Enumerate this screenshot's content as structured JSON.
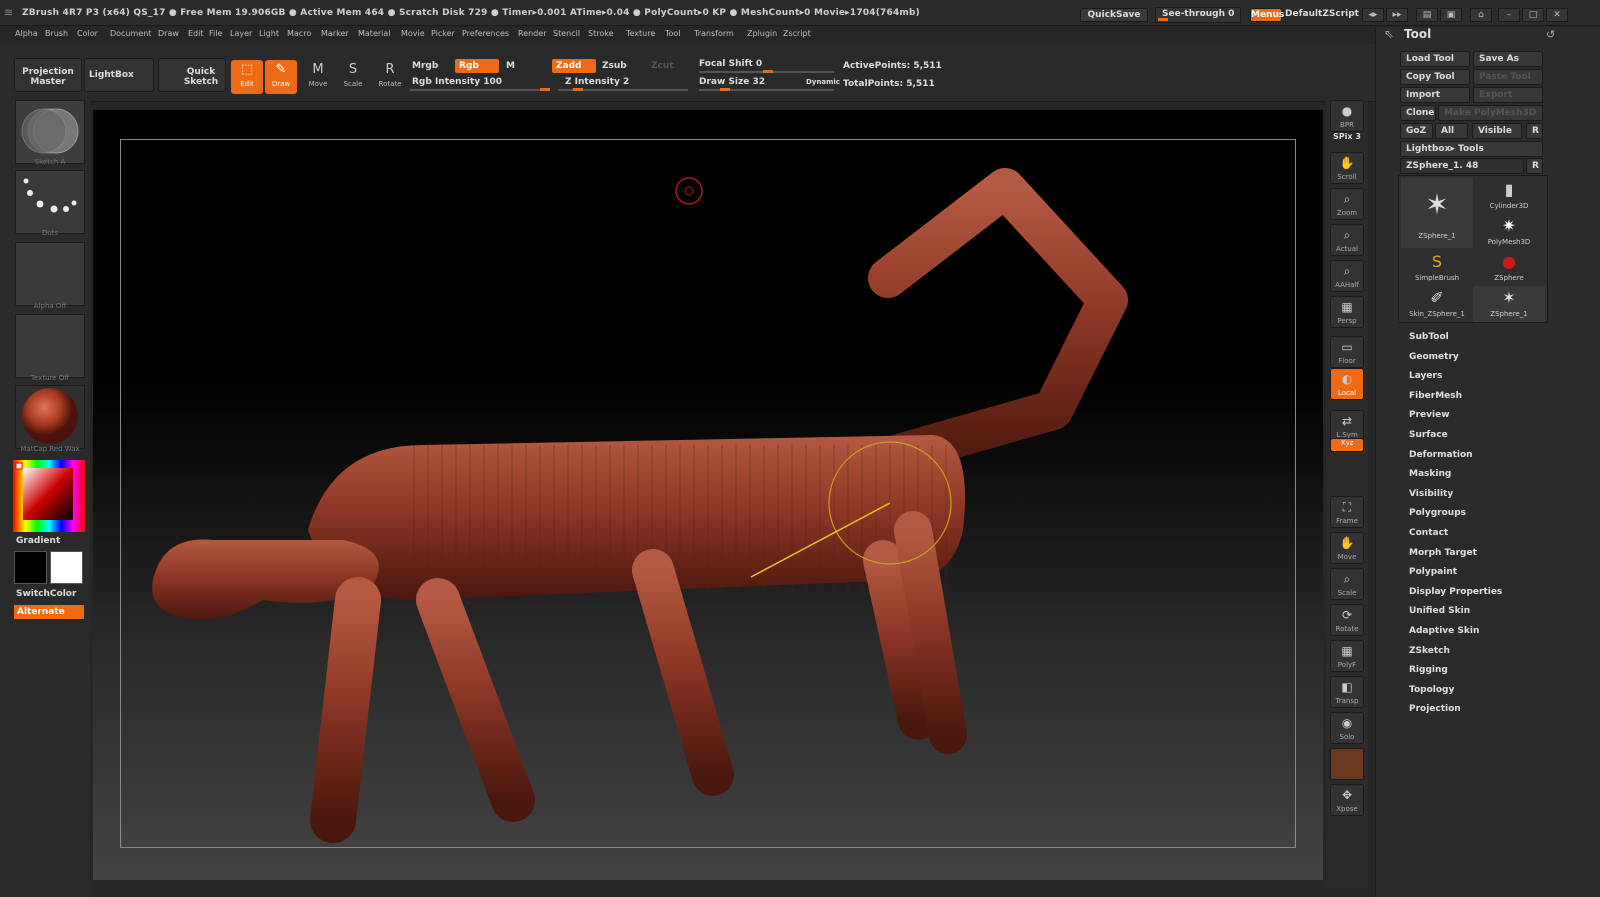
{
  "titlebar": {
    "status": "ZBrush 4R7 P3 (x64)   QS_17     ● Free Mem 19.906GB ● Active Mem 464 ● Scratch Disk 729 ●   Timer▸0.001  ATime▸0.04 ● PolyCount▸0 KP  ● MeshCount▸0   Movie▸1704(764mb)",
    "quicksave": "QuickSave",
    "see_through": "See-through  0",
    "menus": "Menus",
    "default_zscript": "DefaultZScript"
  },
  "menu": [
    "Alpha",
    "Brush",
    "Color",
    "Document",
    "Draw",
    "Edit",
    "File",
    "Layer",
    "Light",
    "Macro",
    "Marker",
    "Material",
    "Movie",
    "Picker",
    "Preferences",
    "Render",
    "Stencil",
    "Stroke",
    "Texture",
    "Tool",
    "Transform",
    "Zplugin",
    "Zscript"
  ],
  "shelf": {
    "projection_master": "Projection Master",
    "lightbox": "LightBox",
    "quick_sketch": "Quick Sketch",
    "tools": [
      {
        "label": "Edit",
        "icon": "⬚"
      },
      {
        "label": "Draw",
        "icon": "✎"
      },
      {
        "label": "Move",
        "icon": "M"
      },
      {
        "label": "Scale",
        "icon": "S"
      },
      {
        "label": "Rotate",
        "icon": "R"
      }
    ],
    "mrgb": "Mrgb",
    "rgb": "Rgb",
    "m": "M",
    "zadd": "Zadd",
    "zsub": "Zsub",
    "zcut": "Zcut",
    "rgb_intensity": "Rgb Intensity 100",
    "z_intensity": "Z Intensity 2",
    "focal_shift": "Focal Shift 0",
    "draw_size": "Draw Size 32",
    "dynamic": "Dynamic",
    "active_points": "ActivePoints: 5,511",
    "total_points": "TotalPoints: 5,511"
  },
  "leftbar": {
    "brush_label": "Sketch A",
    "stroke_label": "Dots",
    "alpha_label": "Alpha Off",
    "texture_label": "Texture Off",
    "material_label": "MatCap Red Wax",
    "gradient": "Gradient",
    "switch_color": "SwitchColor",
    "alternate": "Alternate"
  },
  "rshelf": [
    {
      "label": "BPR",
      "icon": "●"
    },
    {
      "label": "SPix 3",
      "icon": ""
    },
    {
      "label": "Scroll",
      "icon": "✋"
    },
    {
      "label": "Zoom",
      "icon": "⌕"
    },
    {
      "label": "Actual",
      "icon": "⌕"
    },
    {
      "label": "AAHalf",
      "icon": "⌕"
    },
    {
      "label": "Persp",
      "icon": "▦"
    },
    {
      "label": "Floor",
      "icon": "▭"
    },
    {
      "label": "Local",
      "icon": "◐"
    },
    {
      "label": "L.Sym",
      "icon": "⇄"
    },
    {
      "label": "Xyz",
      "icon": "✥"
    },
    {
      "label": "Frame",
      "icon": "⛶"
    },
    {
      "label": "Move",
      "icon": "✋"
    },
    {
      "label": "Scale",
      "icon": "⌕"
    },
    {
      "label": "Rotate",
      "icon": "⟳"
    },
    {
      "label": "PolyF",
      "icon": "▦"
    },
    {
      "label": "Transp",
      "icon": "◧"
    },
    {
      "label": "Solo",
      "icon": "◉"
    },
    {
      "label": "Xpose",
      "icon": "✥"
    }
  ],
  "tool_panel": {
    "title": "Tool",
    "load_tool": "Load Tool",
    "save_as": "Save As",
    "copy_tool": "Copy Tool",
    "paste_tool": "Paste Tool",
    "import": "Import",
    "export": "Export",
    "clone": "Clone",
    "make_polymesh": "Make PolyMesh3D",
    "goz": "GoZ",
    "all": "All",
    "visible": "Visible",
    "r": "R",
    "lightbox_tools": "Lightbox▸ Tools",
    "current_tool": "ZSphere_1. 48",
    "thumbs": [
      {
        "label": "ZSphere_1",
        "icon": "✶"
      },
      {
        "label": "Cylinder3D",
        "icon": "▮"
      },
      {
        "label": "PolyMesh3D",
        "icon": "✷"
      },
      {
        "label": "SimpleBrush",
        "icon": "S"
      },
      {
        "label": "ZSphere",
        "icon": "●"
      },
      {
        "label": "Skin_ZSphere_1",
        "icon": "✐"
      },
      {
        "label": "ZSphere_1",
        "icon": "✶"
      }
    ],
    "sections": [
      "SubTool",
      "Geometry",
      "Layers",
      "FiberMesh",
      "Preview",
      "Surface",
      "Deformation",
      "Masking",
      "Visibility",
      "Polygroups",
      "Contact",
      "Morph Target",
      "Polypaint",
      "Display Properties",
      "Unified Skin",
      "Adaptive Skin",
      "ZSketch",
      "Rigging",
      "Topology",
      "Projection"
    ]
  },
  "colors": {
    "accent": "#ee6a14",
    "model": "#8a3a2a",
    "cursor_ring": "#c8a020",
    "cursor_line": "#e8c020"
  }
}
